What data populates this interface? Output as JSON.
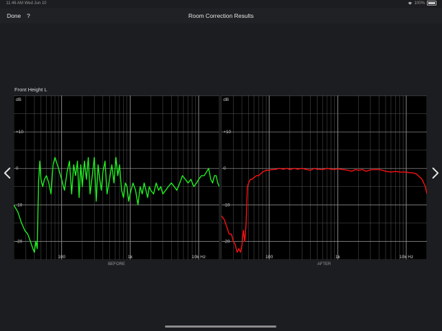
{
  "status_bar": {
    "time": "11:46 AM",
    "date": "Wed Jun 10",
    "battery": "100%"
  },
  "nav": {
    "done_label": "Done",
    "help_label": "?",
    "title": "Room Correction Results"
  },
  "channel": {
    "name": "Front Height L"
  },
  "colors": {
    "before_trace": "#1ff01f",
    "after_trace": "#ff1010",
    "grid": "#5a5a5a"
  },
  "icons": {
    "prev": "chevron-left-icon",
    "next": "chevron-right-icon"
  },
  "chart_data": [
    {
      "type": "line",
      "name": "before",
      "caption": "BEFORE",
      "ylabel": "dB",
      "y_tick_labels": [
        "+10",
        "0",
        "-10",
        "-20"
      ],
      "x_tick_labels": [
        "100",
        "1k",
        "10k Hz"
      ],
      "x_scale": "log",
      "xlim": [
        20,
        20000
      ],
      "ylim": [
        -25,
        20
      ],
      "grid": true,
      "color": "#1ff01f",
      "series": [
        {
          "x": [
            20,
            23,
            26,
            29,
            32,
            35,
            38,
            40,
            42,
            44,
            46,
            48,
            50,
            53,
            56,
            60,
            65,
            70,
            75,
            80,
            90,
            100,
            110,
            120,
            130,
            140,
            150,
            160,
            170,
            180,
            190,
            200,
            215,
            230,
            245,
            260,
            280,
            300,
            320,
            340,
            360,
            380,
            400,
            430,
            460,
            500,
            540,
            580,
            620,
            660,
            700,
            750,
            800,
            850,
            900,
            950,
            1000,
            1100,
            1200,
            1300,
            1400,
            1500,
            1600,
            1700,
            1800,
            1900,
            2000,
            2200,
            2400,
            2600,
            2800,
            3000,
            3300,
            3600,
            4000,
            4400,
            4800,
            5300,
            5800,
            6400,
            7000,
            7700,
            8500,
            9300,
            10000,
            11000,
            12000,
            13000,
            14000,
            15000,
            16000,
            17000,
            18000,
            19000,
            20000
          ],
          "y": [
            -10,
            -12,
            -15,
            -17,
            -18,
            -20,
            -22,
            -23,
            -20,
            -22,
            -4,
            2,
            -3,
            -5,
            -3,
            -2,
            -4,
            -7,
            1,
            3,
            0,
            -3,
            -6,
            -1,
            2,
            -7,
            1,
            -2,
            2,
            -8,
            1,
            -5,
            2,
            -3,
            3,
            -7,
            -2,
            3,
            -9,
            1,
            -3,
            -6,
            -1,
            2,
            -7,
            -3,
            1,
            -4,
            3,
            -2,
            1,
            -6,
            -8,
            -4,
            -5,
            -9,
            -7,
            -4,
            -6,
            -10,
            -5,
            -7,
            -4,
            -6,
            -8,
            -5,
            -6,
            -7,
            -4,
            -6,
            -5,
            -7,
            -6,
            -5,
            -4,
            -5,
            -6,
            -4,
            -2,
            -3,
            -4,
            -3,
            -5,
            -4,
            -3,
            -2,
            -2,
            -1,
            0,
            -3,
            -4,
            -2,
            -2,
            -4,
            -5
          ]
        }
      ]
    },
    {
      "type": "line",
      "name": "after",
      "caption": "AFTER",
      "ylabel": "dB",
      "y_tick_labels": [
        "+10",
        "0",
        "-10",
        "-20"
      ],
      "x_tick_labels": [
        "100",
        "1k",
        "10k Hz"
      ],
      "x_scale": "log",
      "xlim": [
        20,
        20000
      ],
      "ylim": [
        -25,
        20
      ],
      "grid": true,
      "color": "#ff1010",
      "series": [
        {
          "x": [
            20,
            22,
            24,
            26,
            28,
            30,
            32,
            34,
            36,
            38,
            40,
            42,
            44,
            46,
            48,
            50,
            53,
            56,
            60,
            65,
            70,
            80,
            90,
            100,
            110,
            120,
            140,
            160,
            180,
            200,
            230,
            260,
            300,
            350,
            400,
            450,
            500,
            600,
            700,
            800,
            900,
            1000,
            1100,
            1200,
            1400,
            1600,
            1800,
            2000,
            2300,
            2600,
            3000,
            3500,
            4000,
            4500,
            5000,
            6000,
            7000,
            8000,
            9000,
            10000,
            11000,
            12000,
            13000,
            14000,
            15000,
            16000,
            17000,
            18000,
            19000,
            20000
          ],
          "y": [
            -13,
            -14,
            -16,
            -18,
            -18,
            -20,
            -21,
            -23,
            -22,
            -23,
            -21,
            -17,
            -20,
            -15,
            -5,
            -4,
            -3,
            -3,
            -2.5,
            -2,
            -2,
            -1,
            -0.5,
            -0.5,
            -0.3,
            -0.3,
            0,
            -0.2,
            0,
            -0.3,
            0,
            -0.2,
            0,
            -0.3,
            -0.5,
            0,
            -0.2,
            -0.3,
            0,
            -0.2,
            -0.3,
            -0.1,
            -0.2,
            -0.3,
            -0.5,
            -0.8,
            -0.3,
            -0.5,
            -0.3,
            -0.8,
            -0.4,
            -0.3,
            -0.3,
            -0.5,
            -0.8,
            -1,
            -0.8,
            -1,
            -1,
            -1,
            -1.2,
            -1.2,
            -1.3,
            -1.5,
            -2,
            -2.5,
            -3,
            -4,
            -5,
            -7
          ]
        }
      ]
    }
  ]
}
